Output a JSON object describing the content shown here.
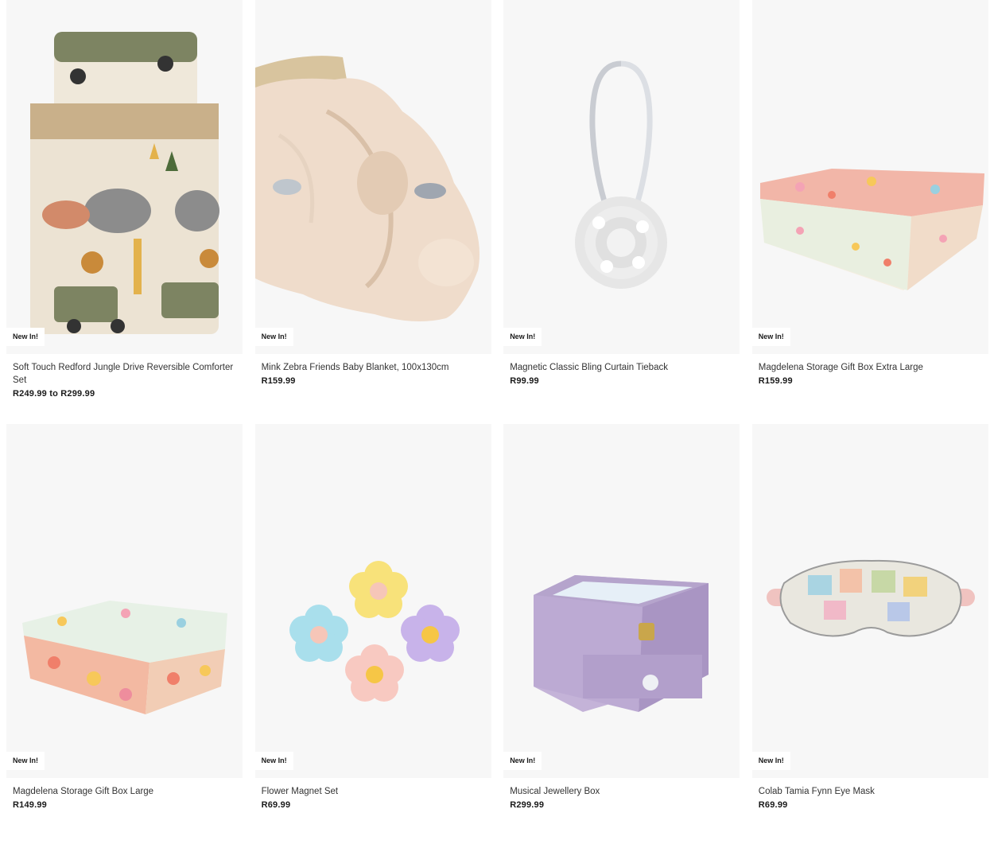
{
  "colors": {
    "card_bg": "#f7f7f7",
    "badge_bg": "#ffffff",
    "text": "#333333"
  },
  "products": [
    {
      "title": "Soft Touch Redford Jungle Drive Reversible Comforter Set",
      "price": "R249.99 to R299.99",
      "badge": "New In!",
      "image_icon": "comforter-set-image"
    },
    {
      "title": "Mink Zebra Friends Baby Blanket, 100x130cm",
      "price": "R159.99",
      "badge": "New In!",
      "image_icon": "baby-blanket-image"
    },
    {
      "title": "Magnetic Classic Bling Curtain Tieback",
      "price": "R99.99",
      "badge": "New In!",
      "image_icon": "curtain-tieback-image"
    },
    {
      "title": "Magdelena Storage Gift Box Extra Large",
      "price": "R159.99",
      "badge": "New In!",
      "image_icon": "gift-box-xl-image"
    },
    {
      "title": "Magdelena Storage Gift Box Large",
      "price": "R149.99",
      "badge": "New In!",
      "image_icon": "gift-box-large-image"
    },
    {
      "title": "Flower Magnet Set",
      "price": "R69.99",
      "badge": "New In!",
      "image_icon": "flower-magnets-image"
    },
    {
      "title": "Musical Jewellery Box",
      "price": "R299.99",
      "badge": "New In!",
      "image_icon": "jewellery-box-image"
    },
    {
      "title": "Colab Tamia Fynn Eye Mask",
      "price": "R69.99",
      "badge": "New In!",
      "image_icon": "eye-mask-image"
    }
  ]
}
